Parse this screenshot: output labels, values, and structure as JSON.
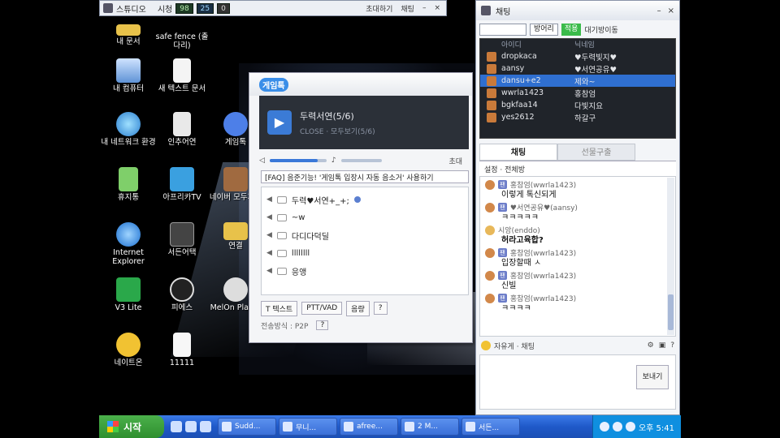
{
  "studio": {
    "title": "스튜디오",
    "view_label": "시청",
    "meter1": "98",
    "meter2": "25",
    "meter3": "0",
    "invite": "초대하기",
    "chat": "채팅"
  },
  "desktop_icons": [
    {
      "label": "내 문서",
      "icon": "folder-icon"
    },
    {
      "label": "safe fence (출다리)",
      "icon": "shield-icon"
    },
    {
      "label": "내 컴퓨터",
      "icon": "computer-icon"
    },
    {
      "label": "새 텍스트 문서",
      "icon": "text-file-icon"
    },
    {
      "label": "내 네트워크 환경",
      "icon": "network-icon"
    },
    {
      "label": "인추어연",
      "icon": "document-icon"
    },
    {
      "label": "게임톡",
      "icon": "chat-bubble-icon"
    },
    {
      "label": "휴지통",
      "icon": "recycle-bin-icon"
    },
    {
      "label": "아프리카TV",
      "icon": "tv-icon"
    },
    {
      "label": "네이버 모두자원",
      "icon": "person-icon"
    },
    {
      "label": "Internet Explorer",
      "icon": "ie-icon"
    },
    {
      "label": "서든어택",
      "icon": "game-icon"
    },
    {
      "label": "연결",
      "icon": "folder-icon"
    },
    {
      "label": "V3 Lite",
      "icon": "antivirus-icon"
    },
    {
      "label": "피에스",
      "icon": "clock-icon"
    },
    {
      "label": "MelOn Player",
      "icon": "music-icon"
    },
    {
      "label": "네이트온",
      "icon": "messenger-icon"
    },
    {
      "label": "11111",
      "icon": "image-file-icon"
    }
  ],
  "game_window": {
    "logo": "게임톡",
    "room_name": "두력서연(5/6)",
    "room_sub": "CLOSE · 모두보기(5/6)",
    "voice_label": "초대",
    "volume_fraction": 0.85,
    "notice": "[FAQ] 음준기능! '게임톡 입장시 자동 음소거' 사용하기",
    "members": [
      "두력♥서연+_+;",
      "~w",
      "다디다덕딜",
      "llllllll",
      "응앵"
    ],
    "tools": [
      "T 텍스트",
      "PTT/VAD",
      "음량",
      "?"
    ],
    "bottom": "전송방식 : P2P"
  },
  "chat_window": {
    "title": "채팅",
    "filter_select": "방어리",
    "go_label": "적용",
    "exit_label": "대기방이동",
    "columns": [
      "아이디",
      "닉네임"
    ],
    "users": [
      {
        "id": "dropkaca",
        "nick": "♥두력빛지♥"
      },
      {
        "id": "aansy",
        "nick": "♥서연공유♥"
      },
      {
        "id": "dansu+e2",
        "nick": "제와~"
      },
      {
        "id": "wwrla1423",
        "nick": "홍참엄"
      },
      {
        "id": "bgkfaa14",
        "nick": "다빛지요"
      },
      {
        "id": "yes2612",
        "nick": "하갈구"
      }
    ],
    "tabs": [
      "채팅",
      "선물구출"
    ],
    "filter": "설정 · 전체방",
    "messages": [
      {
        "user": "홍참엄(wwrla1423)",
        "text": "이렇게 톡신되게"
      },
      {
        "user": "♥서연공유♥(aansy)",
        "text": "ㅋㅋㅋㅋㅋ"
      },
      {
        "user": "시앙(enddo)",
        "text": "허라고육합?"
      },
      {
        "user": "홍참엄(wwrla1423)",
        "text": "입장할때 ㅅ"
      },
      {
        "user": "홍참엄(wwrla1423)",
        "text": "신빌"
      },
      {
        "user": "홍참엄(wwrla1423)",
        "text": "ㅋㅋㅋㅋ"
      }
    ],
    "emoji_label": "자유게 · 채팅",
    "send_label": "보내기"
  },
  "taskbar": {
    "start": "시작",
    "tasks": [
      "Sudd...",
      "무니...",
      "afree...",
      "2 M...",
      "서든..."
    ],
    "clock": "오후 5:41"
  },
  "colors": {
    "taskbar_blue": "#1f59c9",
    "start_green": "#2f8f2f",
    "selected_row": "#2f6fd0"
  }
}
